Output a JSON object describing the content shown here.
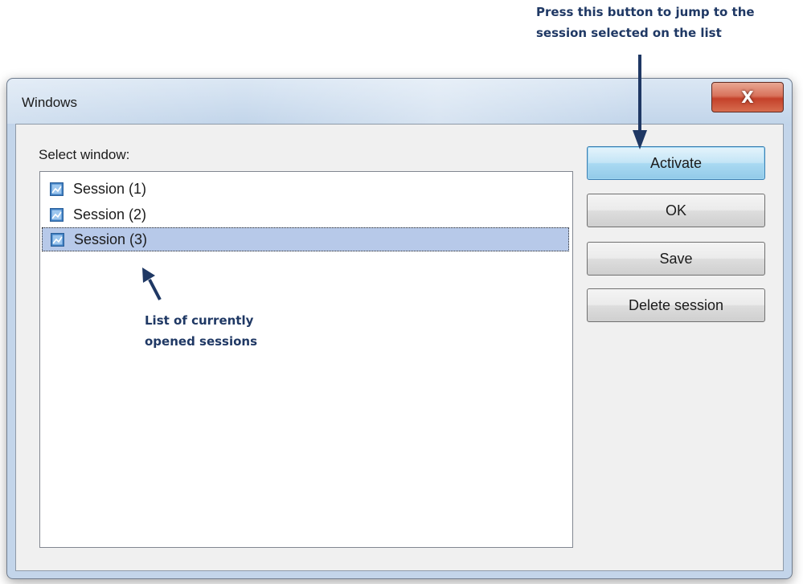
{
  "annotations": {
    "top_callout_line1": "Press this button to jump to the",
    "top_callout_line2": "session selected on the list",
    "bottom_callout_line1": "List of currently",
    "bottom_callout_line2": "opened sessions",
    "arrow_color": "#1f3864"
  },
  "window": {
    "title": "Windows",
    "close_glyph": "X",
    "select_label": "Select window:",
    "sessions": [
      {
        "label": "Session (1)",
        "icon": "session-icon",
        "selected": false
      },
      {
        "label": "Session (2)",
        "icon": "session-icon",
        "selected": false
      },
      {
        "label": "Session (3)",
        "icon": "session-icon",
        "selected": true
      }
    ],
    "buttons": {
      "activate": "Activate",
      "ok": "OK",
      "save": "Save",
      "delete_session": "Delete session"
    }
  },
  "colors": {
    "selection": "#b7c9e9",
    "close_button": "#c4412a",
    "default_button": "#a9d9f2",
    "annotation_text": "#1f3864"
  }
}
